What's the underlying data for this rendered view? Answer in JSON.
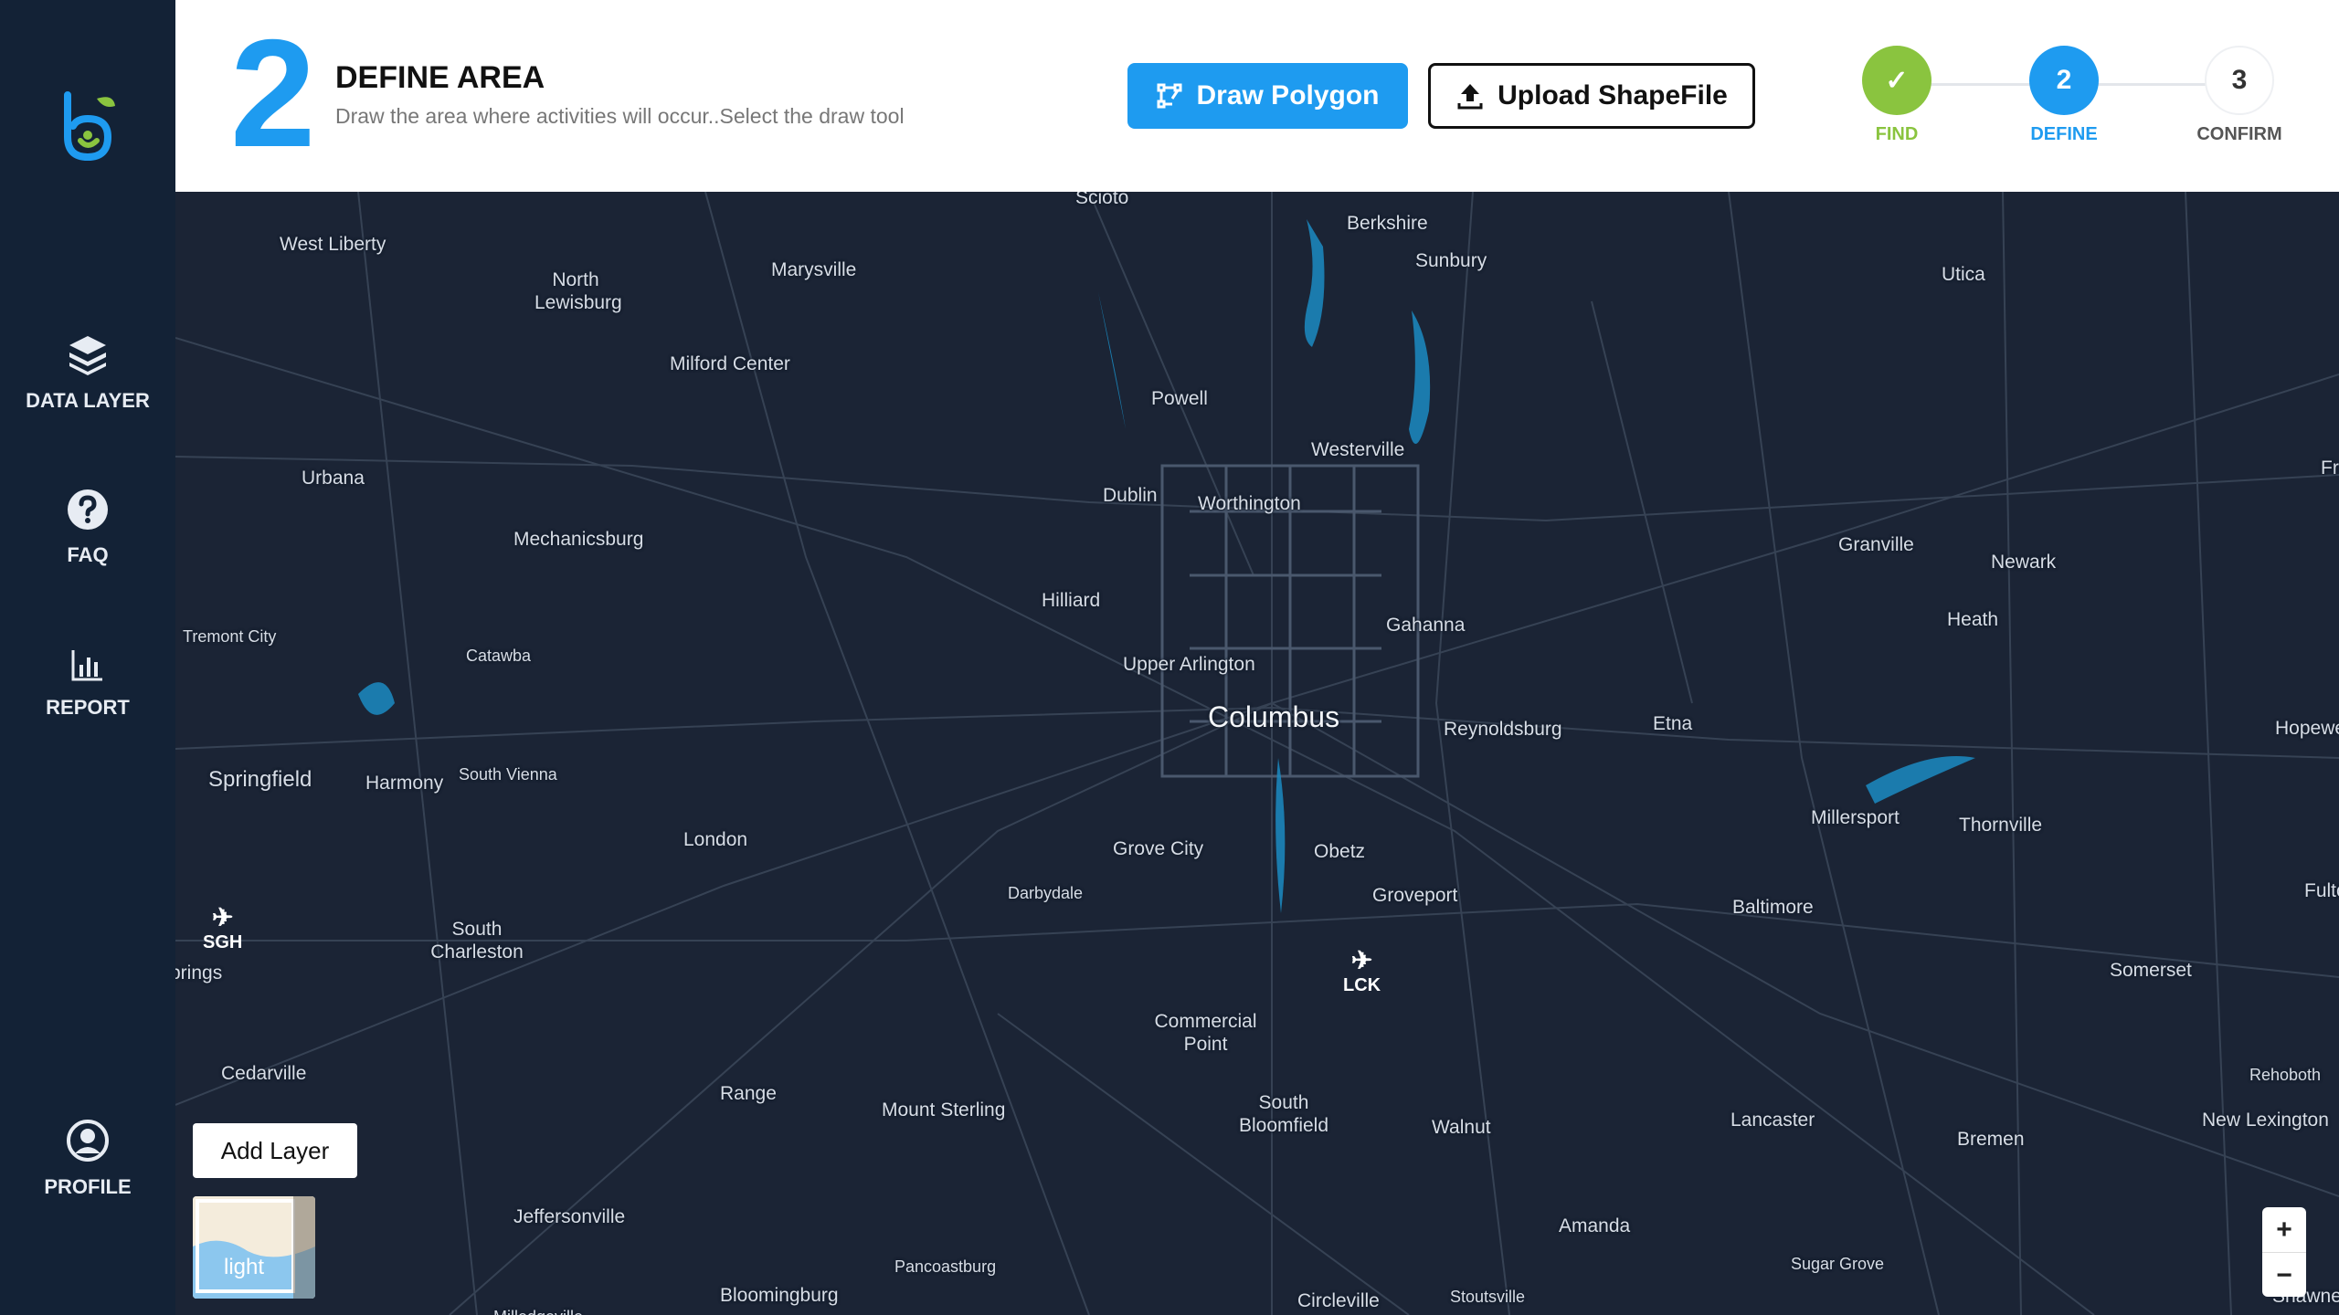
{
  "sidebar": {
    "logo_icon": "brand-logo-icon",
    "items": [
      {
        "label": "DATA LAYER",
        "icon": "layers-icon"
      },
      {
        "label": "FAQ",
        "icon": "help-icon"
      },
      {
        "label": "REPORT",
        "icon": "bar-chart-icon"
      },
      {
        "label": "PROFILE",
        "icon": "user-circle-icon"
      }
    ]
  },
  "header": {
    "step_number": "2",
    "title": "DEFINE AREA",
    "description": "Draw the area where activities will occur..Select the draw tool",
    "draw_button": "Draw Polygon",
    "upload_button": "Upload ShapeFile"
  },
  "stepper": [
    {
      "label": "FIND",
      "state": "done",
      "value": "✓",
      "color": "#8ac43f"
    },
    {
      "label": "DEFINE",
      "state": "active",
      "value": "2",
      "color": "#1e9bf0"
    },
    {
      "label": "CONFIRM",
      "state": "pending",
      "value": "3",
      "color": "#333333"
    }
  ],
  "map": {
    "places": [
      "Scioto",
      "Berkshire",
      "Sunbury",
      "West Liberty",
      "North Lewisburg",
      "Marysville",
      "Utica",
      "Milford Center",
      "Powell",
      "Westerville",
      "Urbana",
      "Dublin",
      "Worthington",
      "Granville",
      "Newark",
      "Mechanicsburg",
      "Hilliard",
      "Gahanna",
      "Heath",
      "Tremont City",
      "Catawba",
      "Upper Arlington",
      "Columbus",
      "Reynoldsburg",
      "Etna",
      "Hopewe",
      "Springfield",
      "Harmony",
      "South Vienna",
      "Millersport",
      "Thornville",
      "London",
      "Grove City",
      "Obetz",
      "Darbydale",
      "Groveport",
      "Baltimore",
      "Fulto",
      "South Charleston",
      "prings",
      "Somerset",
      "Commercial Point",
      "Cedarville",
      "Rehoboth",
      "Range",
      "Mount Sterling",
      "South Bloomfield",
      "Walnut",
      "Lancaster",
      "New Lexington",
      "Bremen",
      "Jeffersonville",
      "Amanda",
      "Pancoastburg",
      "Sugar Grove",
      "Bloomingburg",
      "Circleville",
      "Stoutsville",
      "Shawnee",
      "Fr",
      "Milledgeville"
    ],
    "airports": [
      "SGH",
      "LCK"
    ],
    "add_layer": "Add Layer",
    "basemap_label": "light",
    "zoom_in": "+",
    "zoom_out": "−"
  }
}
